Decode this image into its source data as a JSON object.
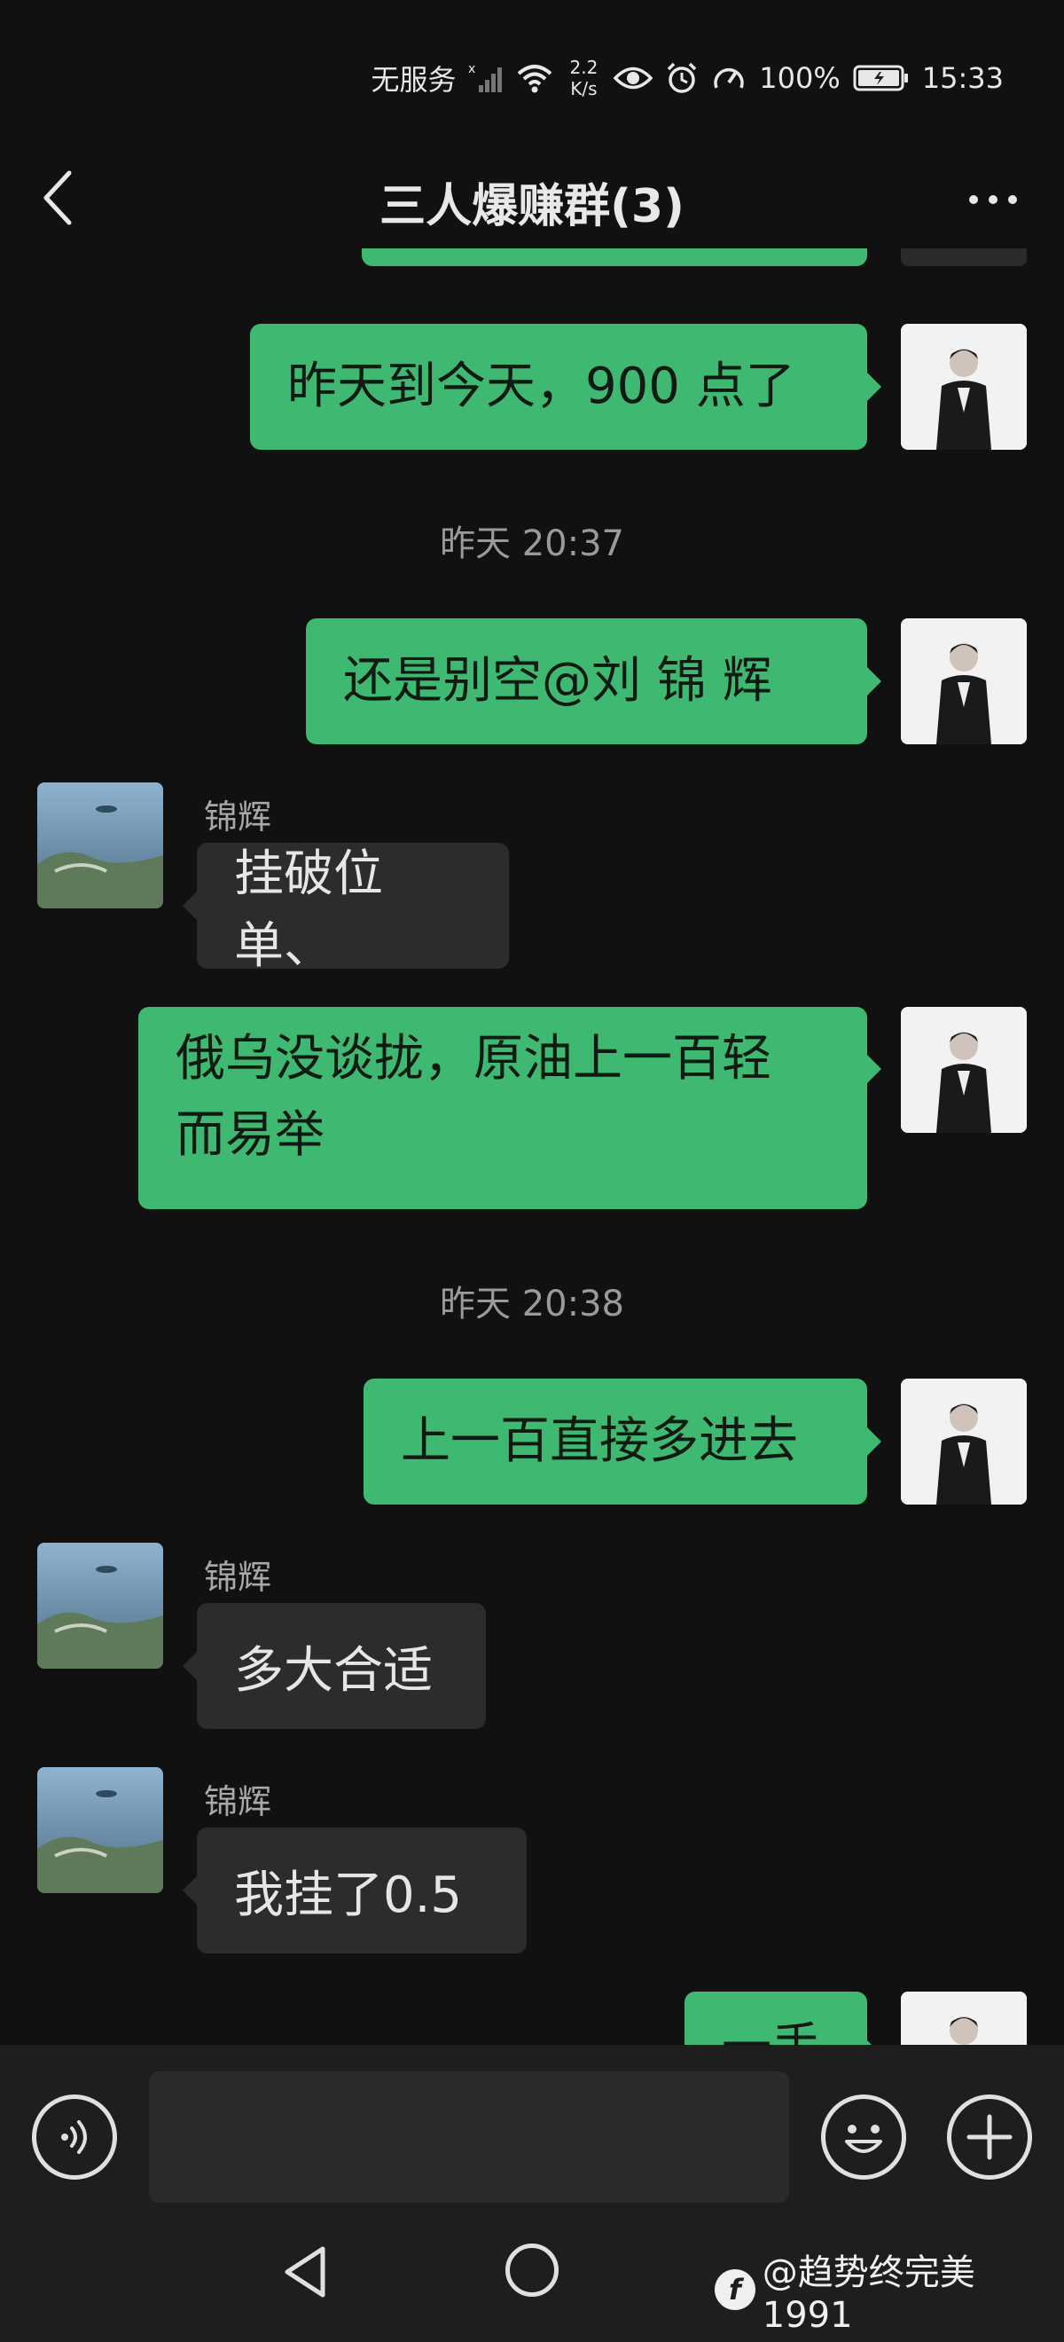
{
  "status_bar": {
    "carrier": "无服务",
    "net_speed_value": "2.2",
    "net_speed_unit": "K/s",
    "battery": "100%",
    "time": "15:33"
  },
  "header": {
    "title": "三人爆赚群(3)"
  },
  "messages": {
    "m1": "昨天到今天，900 点了",
    "t1": "昨天 20:37",
    "m2": "还是别空@刘 锦 辉",
    "s3": "锦辉",
    "m3": "挂破位单、",
    "m4_line1": "俄乌没谈拢，原油上一百轻",
    "m4_line2": "而易举",
    "t2": "昨天 20:38",
    "m5": "上一百直接多进去",
    "s6": "锦辉",
    "m6": "多大合适",
    "s7": "锦辉",
    "m7": "我挂了0.5",
    "m8_partial": "一手"
  },
  "input": {
    "placeholder": ""
  },
  "watermark": {
    "text": "@趋势终完美1991"
  },
  "icons": [
    "back-chevron-icon",
    "more-dots-icon",
    "voice-icon",
    "emoji-icon",
    "plus-icon",
    "nav-back-icon",
    "nav-home-icon",
    "eye-icon",
    "alarm-icon",
    "speed-icon",
    "wifi-icon",
    "signal-icon",
    "battery-icon"
  ],
  "colors": {
    "background": "#111111",
    "outgoing_bubble": "#3fb872",
    "incoming_bubble": "#2c2c2c",
    "bar": "#1e1e1e"
  }
}
